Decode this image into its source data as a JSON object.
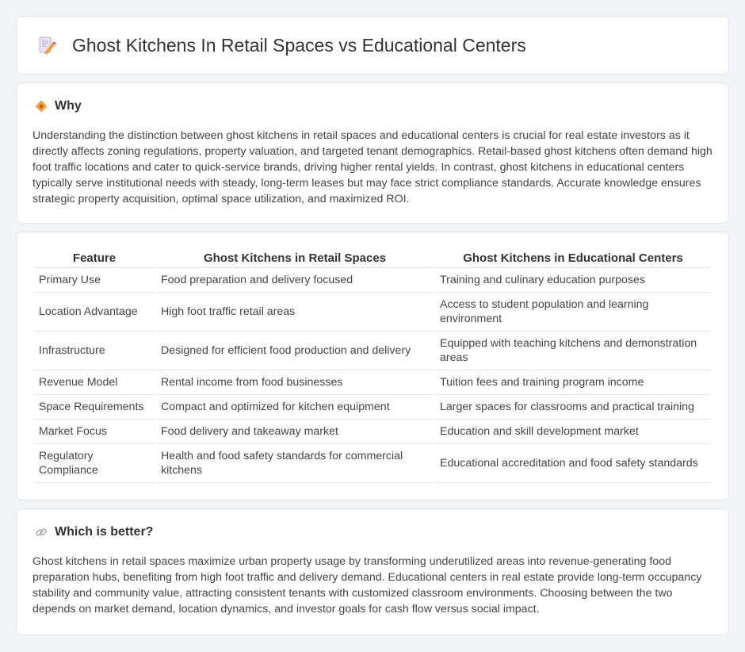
{
  "header": {
    "title": "Ghost Kitchens In Retail Spaces vs Educational Centers",
    "icon": "document-pencil-icon"
  },
  "why": {
    "heading": "Why",
    "icon": "diamond-warning-icon",
    "body": "Understanding the distinction between ghost kitchens in retail spaces and educational centers is crucial for real estate investors as it directly affects zoning regulations, property valuation, and targeted tenant demographics. Retail-based ghost kitchens often demand high foot traffic locations and cater to quick-service brands, driving higher rental yields. In contrast, ghost kitchens in educational centers typically serve institutional needs with steady, long-term leases but may face strict compliance standards. Accurate knowledge ensures strategic property acquisition, optimal space utilization, and maximized ROI."
  },
  "table": {
    "headers": [
      "Feature",
      "Ghost Kitchens in Retail Spaces",
      "Ghost Kitchens in Educational Centers"
    ],
    "rows": [
      [
        "Primary Use",
        "Food preparation and delivery focused",
        "Training and culinary education purposes"
      ],
      [
        "Location Advantage",
        "High foot traffic retail areas",
        "Access to student population and learning environment"
      ],
      [
        "Infrastructure",
        "Designed for efficient food production and delivery",
        "Equipped with teaching kitchens and demonstration areas"
      ],
      [
        "Revenue Model",
        "Rental income from food businesses",
        "Tuition fees and training program income"
      ],
      [
        "Space Requirements",
        "Compact and optimized for kitchen equipment",
        "Larger spaces for classrooms and practical training"
      ],
      [
        "Market Focus",
        "Food delivery and takeaway market",
        "Education and skill development market"
      ],
      [
        "Regulatory Compliance",
        "Health and food safety standards for commercial kitchens",
        "Educational accreditation and food safety standards"
      ]
    ]
  },
  "better": {
    "heading": "Which is better?",
    "icon": "link-icon",
    "body": "Ghost kitchens in retail spaces maximize urban property usage by transforming underutilized areas into revenue-generating food preparation hubs, benefiting from high foot traffic and delivery demand. Educational centers in real estate provide long-term occupancy stability and community value, attracting consistent tenants with customized classroom environments. Choosing between the two depends on market demand, location dynamics, and investor goals for cash flow versus social impact."
  },
  "colors": {
    "accent_orange": "#f0a23a",
    "icon_pink": "#e8607a",
    "background": "#f3f4f7"
  }
}
